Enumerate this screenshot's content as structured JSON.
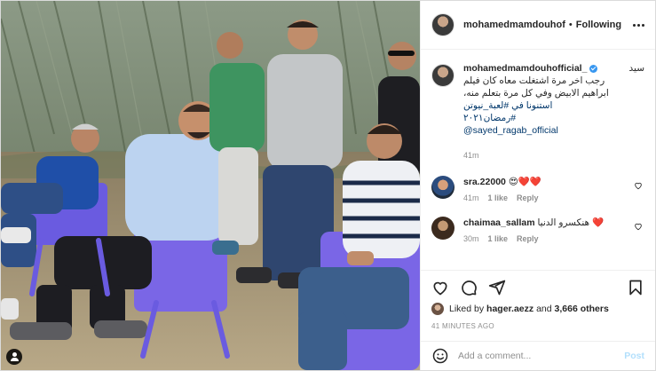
{
  "post": {
    "image_alt": "",
    "author": "mohamedmamdouhof",
    "follow_label": "Following",
    "separator": "•"
  },
  "caption": {
    "username": "mohamedmamdouhofficial_",
    "lines": [
      "سيد",
      "رجب اخر مرة اشتغلت معاه كان فيلم",
      "ابراهيم الابيض وفي كل مرة بتعلم منه،",
      "استنونا في #لعبة_نيوتن",
      "#رمضان٢٠٢١"
    ],
    "mention": "@sayed_ragab_official",
    "time": "41m"
  },
  "comments": [
    {
      "username": "sra.22000",
      "text": "😍❤️❤️",
      "time": "41m",
      "likes": "1 like",
      "reply": "Reply"
    },
    {
      "username": "chaimaa_sallam",
      "text": "هنكسرو الدنيا ❤️",
      "time": "30m",
      "likes": "1 like",
      "reply": "Reply"
    }
  ],
  "likes": {
    "prefix": "Liked by",
    "user": "hager.aezz",
    "and": "and",
    "others": "3,666 others"
  },
  "timestamp": "41 MINUTES AGO",
  "add_comment": {
    "placeholder": "Add a comment...",
    "post_label": "Post"
  },
  "icons": {
    "like": "heart-icon",
    "comment": "comment-icon",
    "share": "share-icon",
    "save": "bookmark-icon",
    "emoji": "emoji-icon",
    "more": "more-icon",
    "user_tag": "user-tag-icon"
  },
  "colors": {
    "link": "#00376b",
    "verified": "#3897f0",
    "muted": "#8e8e8e",
    "post_disabled": "#b2dffc",
    "heart": "#ed4956"
  }
}
